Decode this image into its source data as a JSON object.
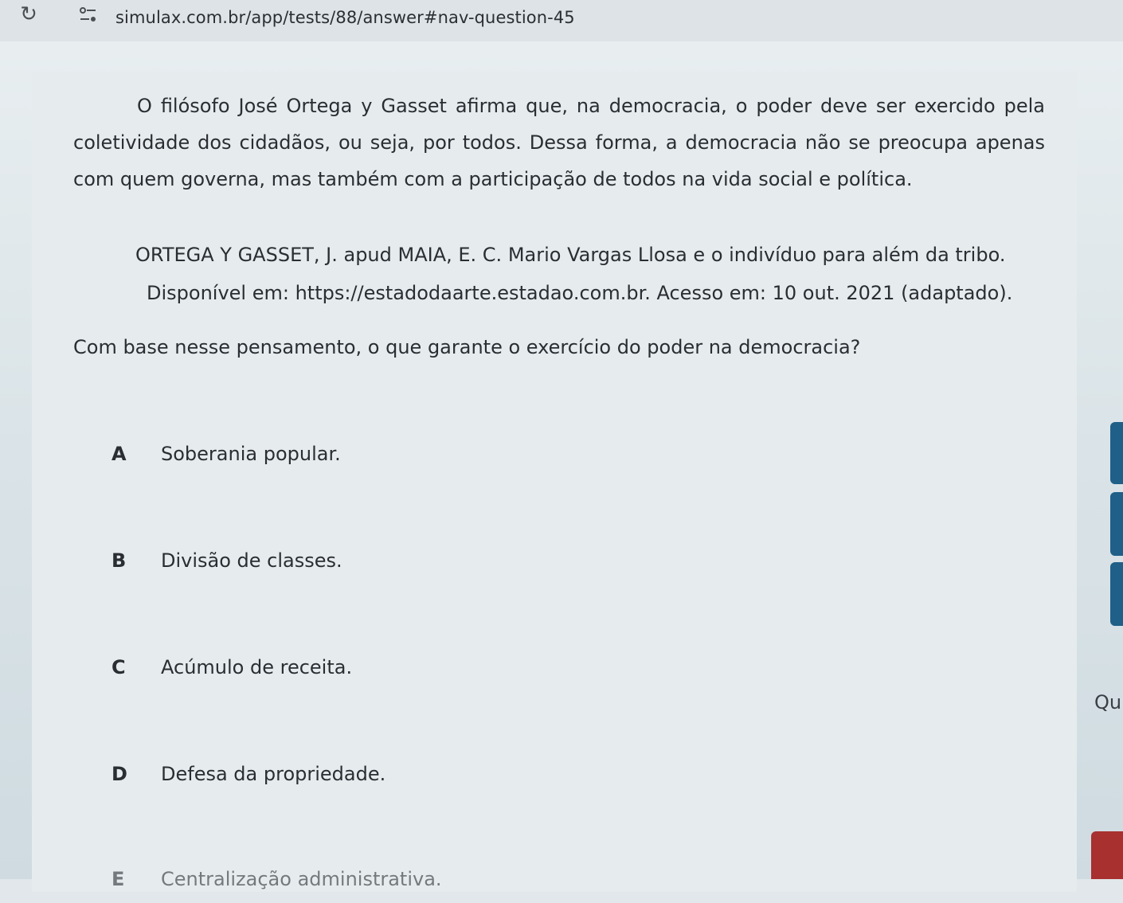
{
  "browser": {
    "url": "simulax.com.br/app/tests/88/answer#nav-question-45"
  },
  "question": {
    "passage": "O filósofo José Ortega y Gasset afirma que, na democracia, o poder deve ser exercido pela coletividade dos cidadãos, ou seja, por todos. Dessa forma, a democracia não se preocupa apenas com quem governa, mas também com a participação de todos na vida social e política.",
    "citation_line1": "ORTEGA Y GASSET, J. apud MAIA, E. C. Mario Vargas Llosa e o indivíduo para além da tribo.",
    "citation_line2": "Disponível em: https://estadodaarte.estadao.com.br. Acesso em: 10 out. 2021 (adaptado).",
    "prompt": "Com base nesse pensamento, o que garante o exercício do poder na democracia?",
    "options": [
      {
        "letter": "A",
        "text": "Soberania popular."
      },
      {
        "letter": "B",
        "text": "Divisão de classes."
      },
      {
        "letter": "C",
        "text": "Acúmulo de receita."
      },
      {
        "letter": "D",
        "text": "Defesa da propriedade."
      },
      {
        "letter": "E",
        "text": "Centralização administrativa."
      }
    ]
  },
  "side_panel": {
    "label": "Qu"
  },
  "colors": {
    "tab_blue": "#1f5f88",
    "alert_red": "#a8302f"
  }
}
